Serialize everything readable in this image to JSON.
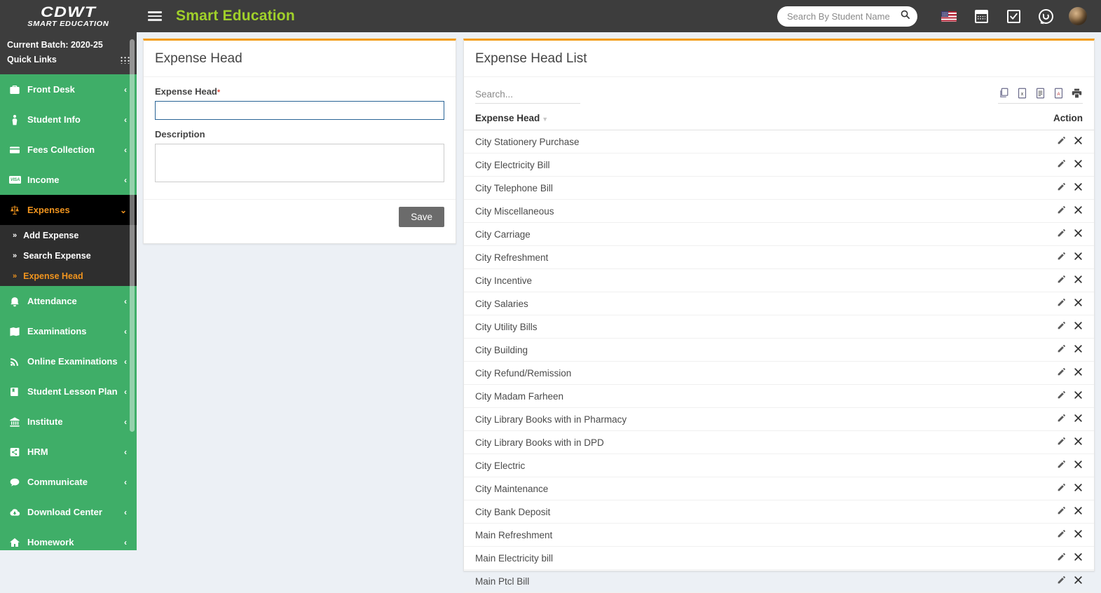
{
  "brand": {
    "line1": "CDWT",
    "line2": "SMART EDUCATION"
  },
  "header": {
    "title": "Smart Education",
    "menu_icon": "hamburger-icon",
    "search": {
      "placeholder": "Search By Student Name",
      "value": "",
      "icon": "search-icon"
    },
    "icons": [
      {
        "name": "us-flag-icon",
        "label": "US Flag"
      },
      {
        "name": "calendar-icon",
        "label": "Calendar"
      },
      {
        "name": "checkbox-icon",
        "label": "Tasks"
      },
      {
        "name": "whatsapp-icon",
        "label": "WhatsApp"
      },
      {
        "name": "avatar",
        "label": "Profile"
      }
    ]
  },
  "sidebar": {
    "batch": "Current Batch: 2020-25",
    "quick_links": "Quick Links",
    "quick_links_icon": "grid-icon",
    "items": [
      {
        "label": "Front Desk",
        "icon": "briefcase-icon",
        "arrow": "‹",
        "active": false
      },
      {
        "label": "Student Info",
        "icon": "user-tie-icon",
        "arrow": "‹",
        "active": false
      },
      {
        "label": "Fees Collection",
        "icon": "card-icon",
        "arrow": "‹",
        "active": false
      },
      {
        "label": "Income",
        "icon": "visa-card-icon",
        "arrow": "‹",
        "active": false
      },
      {
        "label": "Expenses",
        "icon": "balance-scale-icon",
        "arrow": "⌄",
        "active": true
      },
      {
        "label": "Attendance",
        "icon": "bell-icon",
        "arrow": "‹",
        "active": false
      },
      {
        "label": "Examinations",
        "icon": "book-open-icon",
        "arrow": "‹",
        "active": false
      },
      {
        "label": "Online Examinations",
        "icon": "rss-icon",
        "arrow": "‹",
        "active": false
      },
      {
        "label": "Student Lesson Plan",
        "icon": "book-icon",
        "arrow": "‹",
        "active": false
      },
      {
        "label": "Institute",
        "icon": "bank-icon",
        "arrow": "‹",
        "active": false
      },
      {
        "label": "HRM",
        "icon": "share-icon",
        "arrow": "‹",
        "active": false
      },
      {
        "label": "Communicate",
        "icon": "comment-icon",
        "arrow": "‹",
        "active": false
      },
      {
        "label": "Download Center",
        "icon": "cloud-download-icon",
        "arrow": "‹",
        "active": false
      },
      {
        "label": "Homework",
        "icon": "home-icon",
        "arrow": "‹",
        "active": false
      }
    ],
    "submenu": [
      {
        "label": "Add Expense",
        "active": false
      },
      {
        "label": "Search Expense",
        "active": false
      },
      {
        "label": "Expense Head",
        "active": true
      }
    ]
  },
  "form": {
    "title": "Expense Head",
    "expense_head_label": "Expense Head",
    "required_mark": "*",
    "expense_head_value": "",
    "description_label": "Description",
    "description_value": "",
    "save_label": "Save"
  },
  "list": {
    "title": "Expense Head List",
    "search_placeholder": "Search...",
    "search_value": "",
    "export_buttons": [
      {
        "name": "copy-export-icon",
        "label": "Copy"
      },
      {
        "name": "excel-export-icon",
        "label": "Excel"
      },
      {
        "name": "csv-export-icon",
        "label": "CSV"
      },
      {
        "name": "pdf-export-icon",
        "label": "PDF"
      },
      {
        "name": "print-icon",
        "label": "Print"
      }
    ],
    "columns": [
      "Expense Head",
      "Action"
    ],
    "sort_indicator": "▼",
    "rows": [
      "City Stationery Purchase",
      "City Electricity Bill",
      "City Telephone Bill",
      "City Miscellaneous",
      "City Carriage",
      "City Refreshment",
      "City Incentive",
      "City Salaries",
      "City Utility Bills",
      "City Building",
      "City Refund/Remission",
      "City Madam Farheen",
      "City Library Books with in Pharmacy",
      "City Library Books with in DPD",
      "City Electric",
      "City Maintenance",
      "City Bank Deposit",
      "Main Refreshment",
      "Main Electricity bill",
      "Main Ptcl Bill"
    ],
    "row_actions": [
      {
        "name": "edit-icon",
        "label": "Edit"
      },
      {
        "name": "delete-icon",
        "label": "Delete"
      }
    ]
  },
  "colors": {
    "sidebar_green": "#3fae68",
    "accent_orange": "#f39c12",
    "active_orange": "#f0941e",
    "topbar_dark": "#3d3d3d",
    "title_green": "#a0d02a",
    "required_red": "#e74c3c"
  }
}
